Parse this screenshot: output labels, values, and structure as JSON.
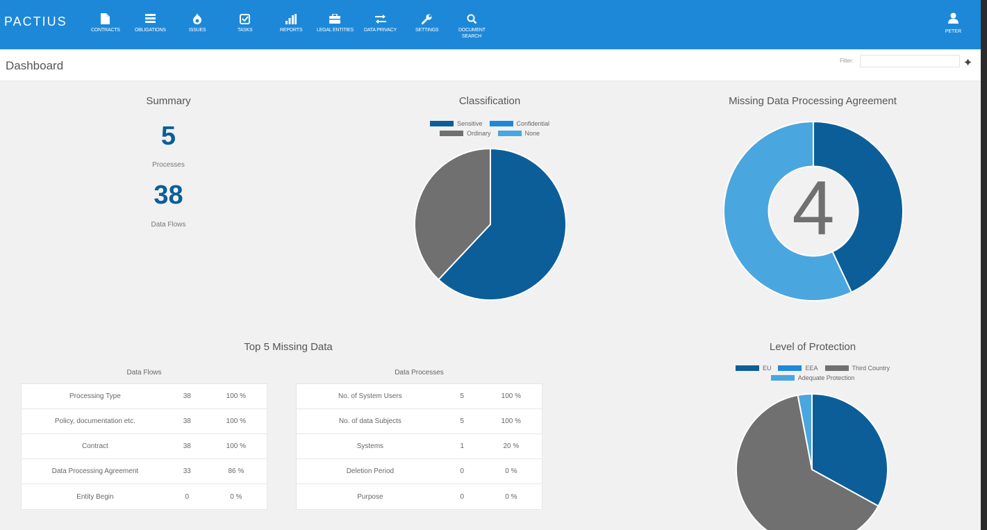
{
  "app": {
    "logo": "PACTIUS"
  },
  "nav": [
    {
      "label": "CONTRACTS",
      "icon": "file-icon"
    },
    {
      "label": "OBLIGATIONS",
      "icon": "list-icon"
    },
    {
      "label": "ISSUES",
      "icon": "flame-icon"
    },
    {
      "label": "TASKS",
      "icon": "check-square-icon"
    },
    {
      "label": "REPORTS",
      "icon": "bar-chart-icon"
    },
    {
      "label": "LEGAL ENTITIES",
      "icon": "briefcase-icon"
    },
    {
      "label": "DATA PRIVACY",
      "icon": "exchange-icon"
    },
    {
      "label": "SETTINGS",
      "icon": "wrench-icon"
    },
    {
      "label": "DOCUMENT SEARCH",
      "icon": "search-icon"
    }
  ],
  "user": {
    "label": "PETER",
    "icon": "user-icon"
  },
  "header": {
    "title": "Dashboard",
    "filter_label": "Filter:",
    "filter_value": ""
  },
  "summary": {
    "title": "Summary",
    "processes_value": "5",
    "processes_label": "Processes",
    "flows_value": "38",
    "flows_label": "Data Flows"
  },
  "classification": {
    "title": "Classification",
    "legend": [
      {
        "name": "Sensitive",
        "color": "#0c5e99"
      },
      {
        "name": "Confidential",
        "color": "#1e88d8"
      },
      {
        "name": "Ordinary",
        "color": "#707070"
      },
      {
        "name": "None",
        "color": "#4aa6de"
      }
    ]
  },
  "missing_dpa": {
    "title": "Missing Data Processing Agreement",
    "value": "4"
  },
  "top5": {
    "title": "Top 5 Missing Data",
    "flows": {
      "title": "Data Flows",
      "rows": [
        {
          "name": "Processing Type",
          "count": "38",
          "pct": "100 %"
        },
        {
          "name": "Policy, documentation etc.",
          "count": "38",
          "pct": "100 %"
        },
        {
          "name": "Contract",
          "count": "38",
          "pct": "100 %"
        },
        {
          "name": "Data Processing Agreement",
          "count": "33",
          "pct": "86 %"
        },
        {
          "name": "Entity Begin",
          "count": "0",
          "pct": "0 %"
        }
      ]
    },
    "processes": {
      "title": "Data Processes",
      "rows": [
        {
          "name": "No. of System Users",
          "count": "5",
          "pct": "100 %"
        },
        {
          "name": "No. of data Subjects",
          "count": "5",
          "pct": "100 %"
        },
        {
          "name": "Systems",
          "count": "1",
          "pct": "20 %"
        },
        {
          "name": "Deletion Period",
          "count": "0",
          "pct": "0 %"
        },
        {
          "name": "Purpose",
          "count": "0",
          "pct": "0 %"
        }
      ]
    }
  },
  "protection": {
    "title": "Level of Protection",
    "legend": [
      {
        "name": "EU",
        "color": "#0c5e99"
      },
      {
        "name": "EEA",
        "color": "#1e88d8"
      },
      {
        "name": "Third Country",
        "color": "#707070"
      },
      {
        "name": "Adequate Protection",
        "color": "#4aa6de"
      }
    ]
  },
  "chart_data": [
    {
      "type": "pie",
      "title": "Classification",
      "categories": [
        "Sensitive",
        "Confidential",
        "Ordinary",
        "None"
      ],
      "values": [
        62,
        0,
        38,
        0
      ]
    },
    {
      "type": "pie",
      "title": "Missing Data Processing Agreement",
      "categories": [
        "Sensitive",
        "None"
      ],
      "values": [
        43,
        57
      ],
      "center_value": "4"
    },
    {
      "type": "pie",
      "title": "Level of Protection",
      "categories": [
        "EU",
        "EEA",
        "Third Country",
        "Adequate Protection"
      ],
      "values": [
        33,
        0,
        64,
        3
      ]
    }
  ]
}
